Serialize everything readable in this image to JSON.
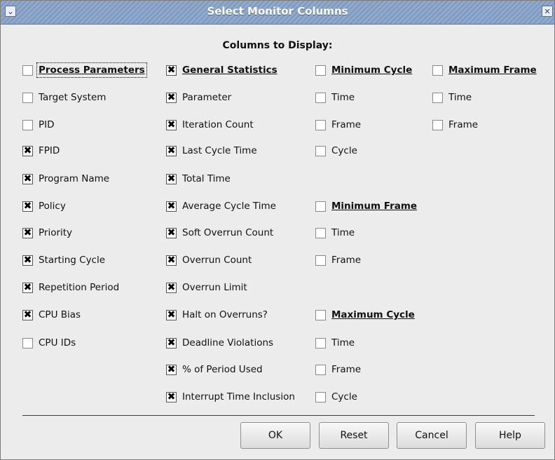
{
  "window": {
    "title": "Select Monitor Columns"
  },
  "heading": "Columns to Display:",
  "col1": [
    {
      "label": "Process Parameters",
      "checked": false,
      "group": true
    },
    {
      "label": "Target System",
      "checked": false
    },
    {
      "label": "PID",
      "checked": false
    },
    {
      "label": "FPID",
      "checked": true
    },
    {
      "label": "Program Name",
      "checked": true
    },
    {
      "label": "Policy",
      "checked": true
    },
    {
      "label": "Priority",
      "checked": true
    },
    {
      "label": "Starting Cycle",
      "checked": true
    },
    {
      "label": "Repetition Period",
      "checked": true
    },
    {
      "label": "CPU Bias",
      "checked": true
    },
    {
      "label": "CPU IDs",
      "checked": false
    }
  ],
  "col2": [
    {
      "label": "General Statistics",
      "checked": true,
      "group": true
    },
    {
      "label": "Parameter",
      "checked": true
    },
    {
      "label": "Iteration Count",
      "checked": true
    },
    {
      "label": "Last Cycle Time",
      "checked": true
    },
    {
      "label": "Total Time",
      "checked": true
    },
    {
      "label": "Average Cycle Time",
      "checked": true
    },
    {
      "label": "Soft Overrun Count",
      "checked": true
    },
    {
      "label": "Overrun Count",
      "checked": true
    },
    {
      "label": "Overrun Limit",
      "checked": true
    },
    {
      "label": "Halt on Overruns?",
      "checked": true
    },
    {
      "label": "Deadline Violations",
      "checked": true
    },
    {
      "label": "% of Period Used",
      "checked": true
    },
    {
      "label": "Interrupt Time Inclusion",
      "checked": true
    }
  ],
  "min_cycle": [
    {
      "label": "Minimum Cycle",
      "checked": false,
      "group": true
    },
    {
      "label": "Time",
      "checked": false
    },
    {
      "label": "Frame",
      "checked": false
    },
    {
      "label": "Cycle",
      "checked": false
    }
  ],
  "min_frame": [
    {
      "label": "Minimum Frame",
      "checked": false,
      "group": true
    },
    {
      "label": "Time",
      "checked": false
    },
    {
      "label": "Frame",
      "checked": false
    }
  ],
  "max_cycle": [
    {
      "label": "Maximum Cycle",
      "checked": false,
      "group": true
    },
    {
      "label": "Time",
      "checked": false
    },
    {
      "label": "Frame",
      "checked": false
    },
    {
      "label": "Cycle",
      "checked": false
    }
  ],
  "max_frame": [
    {
      "label": "Maximum Frame",
      "checked": false,
      "group": true
    },
    {
      "label": "Time",
      "checked": false
    },
    {
      "label": "Frame",
      "checked": false
    }
  ],
  "buttons": {
    "ok": "OK",
    "reset": "Reset",
    "cancel": "Cancel",
    "help": "Help"
  },
  "icons": {
    "menu": "chevron-down-icon",
    "close": "close-icon",
    "check": "x-mark-icon"
  }
}
